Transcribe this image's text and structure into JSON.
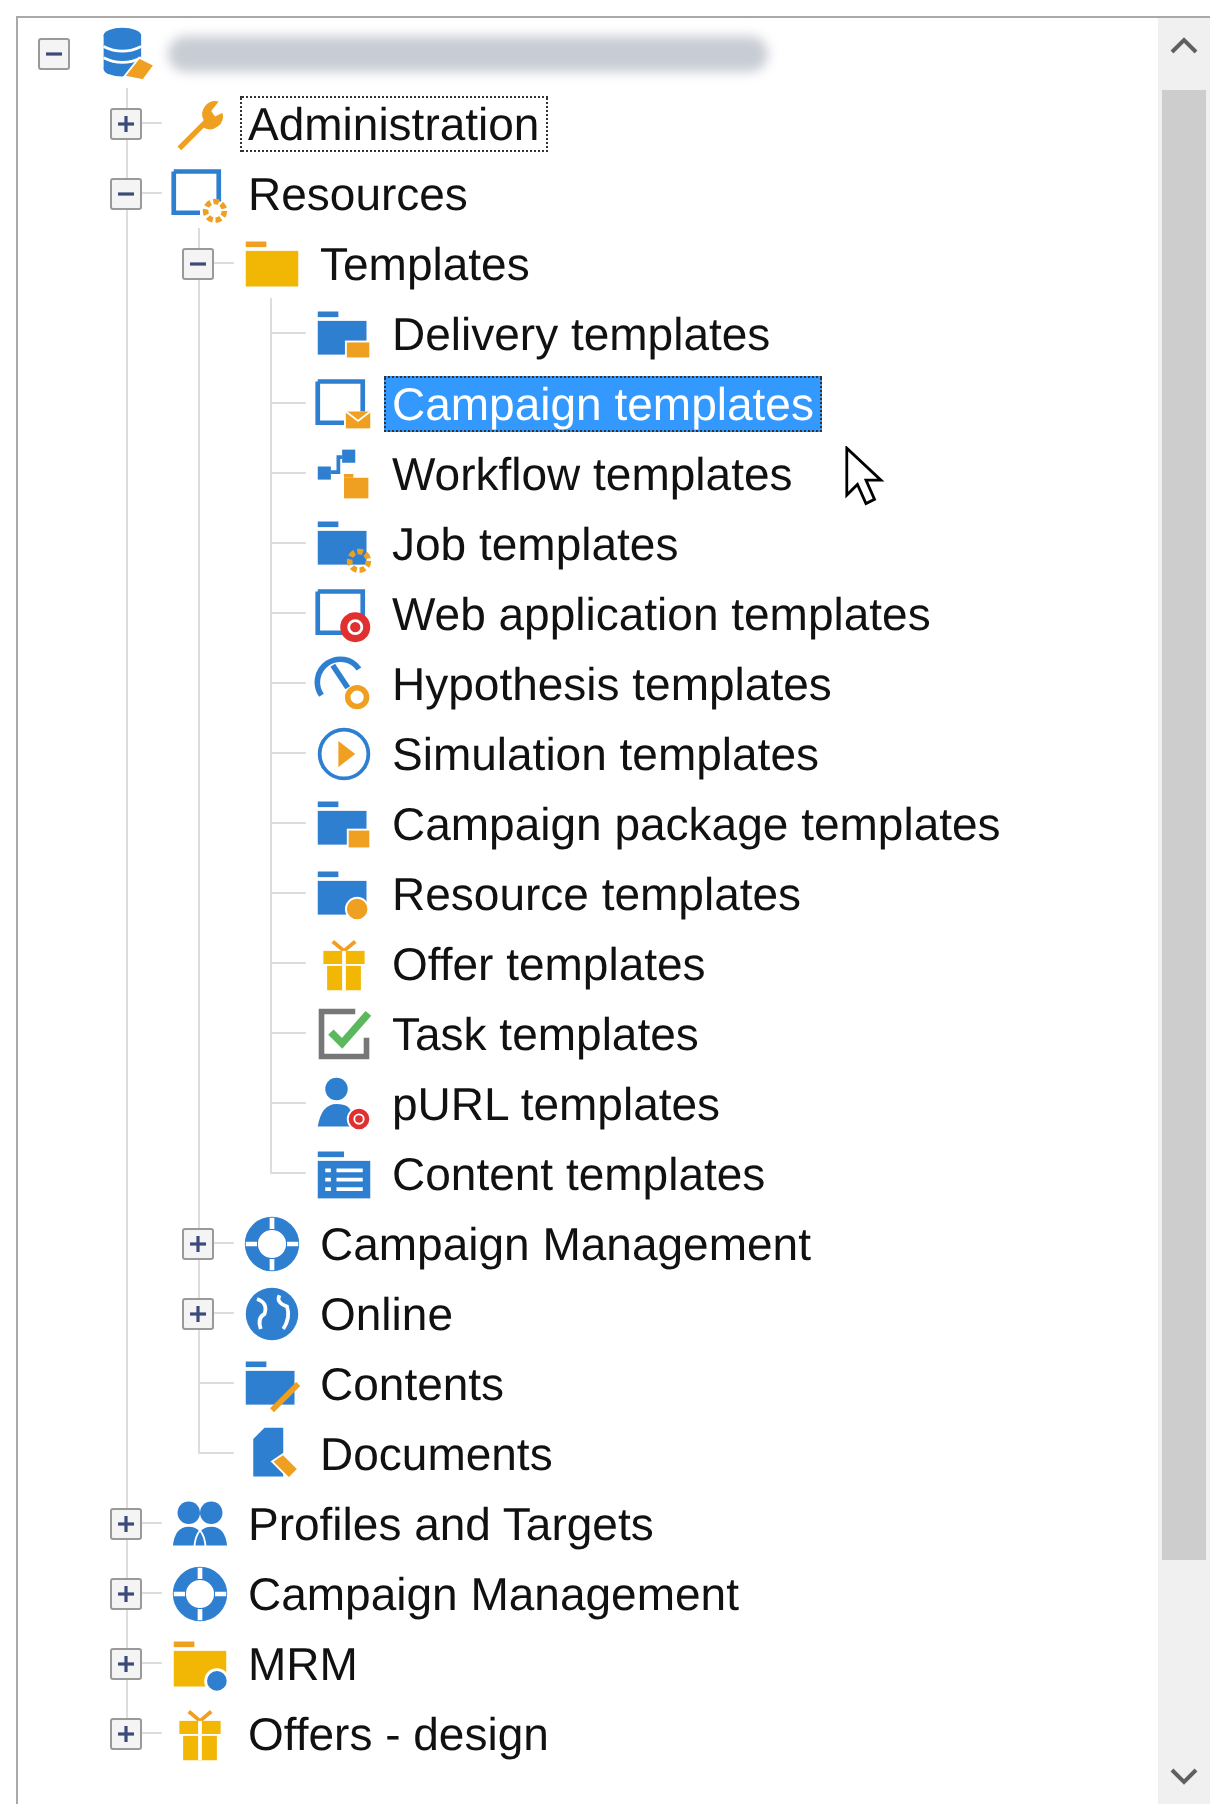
{
  "tree": {
    "nodes": [
      {
        "kind": "database",
        "expanded": true,
        "children": [
          {
            "label": "Administration",
            "kind": "wrench",
            "expanded": false,
            "selected": false,
            "focused": true
          },
          {
            "label": "Resources",
            "kind": "window-gear",
            "expanded": true,
            "selected": false,
            "focused": false,
            "children": [
              {
                "label": "Templates",
                "kind": "folder",
                "expanded": true,
                "selected": false,
                "focused": false,
                "children": [
                  {
                    "label": "Delivery templates",
                    "kind": "folder-mail",
                    "selected": false,
                    "focused": false
                  },
                  {
                    "label": "Campaign templates",
                    "kind": "window-mail",
                    "selected": true,
                    "focused": true
                  },
                  {
                    "label": "Workflow templates",
                    "kind": "workflow",
                    "selected": false,
                    "focused": false
                  },
                  {
                    "label": "Job templates",
                    "kind": "folder-gear",
                    "selected": false,
                    "focused": false
                  },
                  {
                    "label": "Web application templates",
                    "kind": "window-at",
                    "selected": false,
                    "focused": false
                  },
                  {
                    "label": "Hypothesis templates",
                    "kind": "gauge",
                    "selected": false,
                    "focused": false
                  },
                  {
                    "label": "Simulation templates",
                    "kind": "play",
                    "selected": false,
                    "focused": false
                  },
                  {
                    "label": "Campaign package templates",
                    "kind": "folder-box",
                    "selected": false,
                    "focused": false
                  },
                  {
                    "label": "Resource templates",
                    "kind": "folder-globe",
                    "selected": false,
                    "focused": false
                  },
                  {
                    "label": "Offer templates",
                    "kind": "gift",
                    "selected": false,
                    "focused": false
                  },
                  {
                    "label": "Task templates",
                    "kind": "task",
                    "selected": false,
                    "focused": false
                  },
                  {
                    "label": "pURL templates",
                    "kind": "person-at",
                    "selected": false,
                    "focused": false
                  },
                  {
                    "label": "Content templates",
                    "kind": "list",
                    "selected": false,
                    "focused": false
                  }
                ]
              },
              {
                "label": "Campaign Management",
                "kind": "lifebuoy",
                "expanded": false,
                "selected": false,
                "focused": false
              },
              {
                "label": "Online",
                "kind": "globe",
                "expanded": false,
                "selected": false,
                "focused": false
              },
              {
                "label": "Contents",
                "kind": "folder-pencil",
                "selected": false,
                "focused": false
              },
              {
                "label": "Documents",
                "kind": "document-tag",
                "selected": false,
                "focused": false
              }
            ]
          },
          {
            "label": "Profiles and Targets",
            "kind": "people",
            "expanded": false,
            "selected": false,
            "focused": false
          },
          {
            "label": "Campaign Management",
            "kind": "lifebuoy",
            "expanded": false,
            "selected": false,
            "focused": false
          },
          {
            "label": "MRM",
            "kind": "folder-plus",
            "expanded": false,
            "selected": false,
            "focused": false
          },
          {
            "label": "Offers - design",
            "kind": "gift",
            "expanded": false,
            "selected": false,
            "focused": false
          }
        ]
      }
    ]
  }
}
